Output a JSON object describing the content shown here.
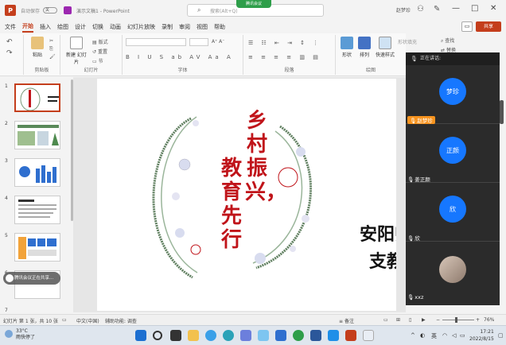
{
  "titlebar": {
    "autosave_label": "自动保存",
    "autosave_state": "关",
    "doc_title": "演示文稿1 - PowerPoint",
    "search_placeholder": "搜索(Alt+Q)",
    "meeting_badge": "腾讯会议",
    "user_name": "赵梦珍"
  },
  "menu": {
    "items": [
      "文件",
      "开始",
      "插入",
      "绘图",
      "设计",
      "切换",
      "动画",
      "幻灯片放映",
      "录制",
      "审阅",
      "视图",
      "帮助"
    ],
    "active_index": 1,
    "share_label": "共享"
  },
  "ribbon": {
    "groups": [
      "剪贴板",
      "幻灯片",
      "字体",
      "段落",
      "绘图"
    ],
    "paste_label": "粘贴",
    "new_slide_label": "新建\n幻灯片",
    "layout_label": "版式",
    "reset_label": "重置",
    "section_label": "节",
    "shape_label": "形状",
    "arrange_label": "排列",
    "quick_style_label": "快速样式",
    "shape_fill_label": "形状填充",
    "find_label": "查找",
    "replace_label": "替换"
  },
  "thumbs": [
    {
      "num": "1",
      "selected": true
    },
    {
      "num": "2",
      "selected": false
    },
    {
      "num": "3",
      "selected": false
    },
    {
      "num": "4",
      "selected": false
    },
    {
      "num": "5",
      "selected": false
    },
    {
      "num": "6",
      "selected": false
    },
    {
      "num": "7",
      "selected": false
    }
  ],
  "slide": {
    "title_col1": "乡村振兴，",
    "title_col2": "教育先行",
    "side_line1": "安阳师",
    "side_line2": "支教"
  },
  "meeting": {
    "speaking_label": "正在讲话:",
    "participants": [
      {
        "avatar_text": "梦珍",
        "name": "赵梦珍",
        "highlight": true
      },
      {
        "avatar_text": "正颜",
        "name": "姜正颜",
        "highlight": false
      },
      {
        "avatar_text": "欣",
        "name": "欣",
        "highlight": false
      },
      {
        "avatar_text": "",
        "name": "xxz",
        "highlight": false
      }
    ]
  },
  "statusbar": {
    "slide_info": "幻灯片 第 1 张，共 10 张",
    "language": "中文(中国)",
    "accessibility": "辅助功能: 调查",
    "notes": "备注",
    "zoom": "76%"
  },
  "taskbar": {
    "weather_temp": "33°C",
    "weather_desc": "雨快停了",
    "ime": "英",
    "time": "17:21",
    "date": "2022/8/15"
  },
  "toast": {
    "text": "腾讯会议正在共享..."
  },
  "colors": {
    "accent": "#c43e1c",
    "title_red": "#c0141a",
    "avatar_blue": "#1677ff",
    "panel_bg": "#2b2b2b"
  }
}
